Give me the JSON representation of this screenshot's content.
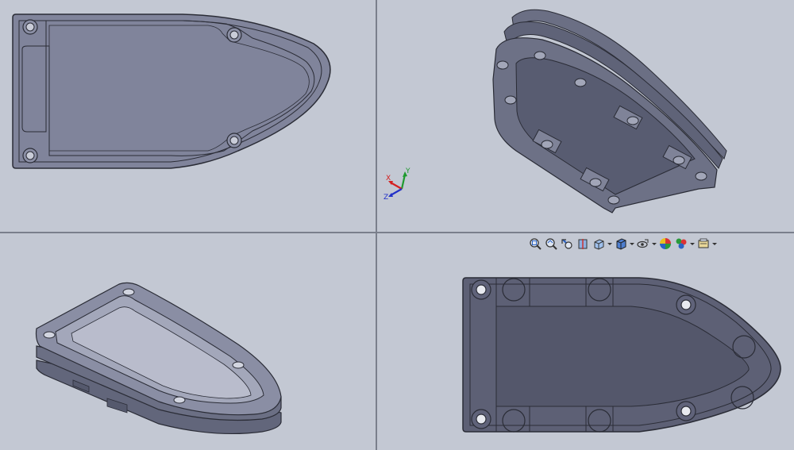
{
  "app": {
    "window_title": ""
  },
  "viewports": [
    {
      "id": "top-left",
      "view": "top"
    },
    {
      "id": "top-right",
      "view": "isometric-tilted"
    },
    {
      "id": "bottom-left",
      "view": "isometric"
    },
    {
      "id": "bottom-right",
      "view": "bottom"
    }
  ],
  "triad": {
    "x_label": "X",
    "y_label": "Y",
    "z_label": "Z",
    "x_color": "#d42020",
    "y_color": "#1f9a2f",
    "z_color": "#2231c8"
  },
  "toolbar": {
    "buttons": [
      {
        "icon": "zoom-to-fit-icon",
        "has_dropdown": false
      },
      {
        "icon": "zoom-to-area-icon",
        "has_dropdown": false
      },
      {
        "icon": "previous-view-icon",
        "has_dropdown": false
      },
      {
        "icon": "section-view-icon",
        "has_dropdown": false
      },
      {
        "icon": "view-orientation-icon",
        "has_dropdown": true
      },
      {
        "icon": "display-style-icon",
        "has_dropdown": true
      },
      {
        "icon": "hide-show-items-icon",
        "has_dropdown": true
      },
      {
        "icon": "edit-appearance-icon",
        "has_dropdown": false
      },
      {
        "icon": "apply-scene-icon",
        "has_dropdown": true
      },
      {
        "icon": "view-settings-icon",
        "has_dropdown": true
      }
    ]
  },
  "colors": {
    "background": "#c3c8d3",
    "part_face": "#7d8199",
    "part_dark": "#5a5d70",
    "divider": "#7a7f8c"
  }
}
